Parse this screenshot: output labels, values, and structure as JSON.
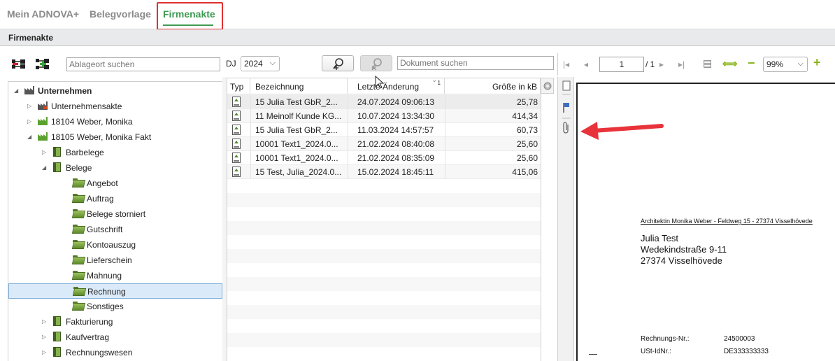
{
  "nav": {
    "items": [
      "Mein ADNOVA+",
      "Belegvorlage",
      "Firmenakte"
    ],
    "active": "Firmenakte",
    "accent_color": "#3d9a52",
    "highlight_color": "#e03030"
  },
  "title": "Firmenakte",
  "tree_toolbar": {
    "expand_icon": "tree-expand-icon",
    "collapse_icon": "tree-collapse-icon",
    "search_placeholder": "Ablageort suchen",
    "dj_label": "DJ",
    "dj_value": "2024"
  },
  "doc_search_placeholder": "Dokument suchen",
  "tree": [
    {
      "label": "Unternehmen",
      "level": 0,
      "expanded": true,
      "icon": "factory-icon",
      "bold": true
    },
    {
      "label": "Unternehmensakte",
      "level": 1,
      "expanded": false,
      "icon": "factory-icon"
    },
    {
      "label": "18104 Weber, Monika",
      "level": 1,
      "expanded": false,
      "icon": "factory-green-icon"
    },
    {
      "label": "18105 Weber, Monika Fakt",
      "level": 1,
      "expanded": true,
      "icon": "factory-green-icon"
    },
    {
      "label": "Barbelege",
      "level": 2,
      "expanded": false,
      "icon": "book-icon"
    },
    {
      "label": "Belege",
      "level": 2,
      "expanded": true,
      "icon": "book-icon"
    },
    {
      "label": "Angebot",
      "level": 3,
      "icon": "folder-icon"
    },
    {
      "label": "Auftrag",
      "level": 3,
      "icon": "folder-icon"
    },
    {
      "label": "Belege storniert",
      "level": 3,
      "icon": "folder-icon"
    },
    {
      "label": "Gutschrift",
      "level": 3,
      "icon": "folder-icon"
    },
    {
      "label": "Kontoauszug",
      "level": 3,
      "icon": "folder-icon"
    },
    {
      "label": "Lieferschein",
      "level": 3,
      "icon": "folder-icon"
    },
    {
      "label": "Mahnung",
      "level": 3,
      "icon": "folder-icon"
    },
    {
      "label": "Rechnung",
      "level": 3,
      "icon": "folder-icon",
      "selected": true
    },
    {
      "label": "Sonstiges",
      "level": 3,
      "icon": "folder-icon"
    },
    {
      "label": "Fakturierung",
      "level": 2,
      "expanded": false,
      "icon": "book-icon"
    },
    {
      "label": "Kaufvertrag",
      "level": 2,
      "expanded": false,
      "icon": "book-icon"
    },
    {
      "label": "Rechnungswesen",
      "level": 2,
      "expanded": false,
      "icon": "book-icon"
    }
  ],
  "doc_table": {
    "columns": [
      "Typ",
      "Bezeichnung",
      "Letzte Änderung",
      "Größe in kB"
    ],
    "sort_indicator": "1",
    "rows": [
      {
        "typ": "pdf-icon",
        "bezeichnung": "15 Julia Test GbR_2...",
        "datum": "24.07.2024 09:06:13",
        "groesse": "25,78"
      },
      {
        "typ": "pdf-icon",
        "bezeichnung": "11 Meinolf Kunde KG...",
        "datum": "10.07.2024 13:34:30",
        "groesse": "414,34"
      },
      {
        "typ": "pdf-icon",
        "bezeichnung": "15 Julia Test GbR_2...",
        "datum": "11.03.2024 14:57:57",
        "groesse": "60,73"
      },
      {
        "typ": "pdf-icon",
        "bezeichnung": "10001 Text1_2024.0...",
        "datum": "21.02.2024 08:40:08",
        "groesse": "25,60"
      },
      {
        "typ": "pdf-icon",
        "bezeichnung": "10001 Text1_2024.0...",
        "datum": "21.02.2024 08:35:09",
        "groesse": "25,60"
      },
      {
        "typ": "pdf-icon",
        "bezeichnung": "15 Test, Julia_2024.0...",
        "datum": "15.02.2024 18:45:11",
        "groesse": "415,06"
      }
    ]
  },
  "preview": {
    "page_current": "1",
    "page_total": "/ 1",
    "zoom": "99%",
    "sender_line": "Architektin Monika Weber - Feldweg 15 - 27374 Visselhövede",
    "recipient": [
      "Julia Test",
      "Wedekindstraße 9-11",
      "27374 Visselhövede"
    ],
    "fields": [
      {
        "label": "Rechnungs-Nr.:",
        "value": "24500003"
      },
      {
        "label": "USt-IdNr.:",
        "value": "DE333333333"
      }
    ]
  }
}
